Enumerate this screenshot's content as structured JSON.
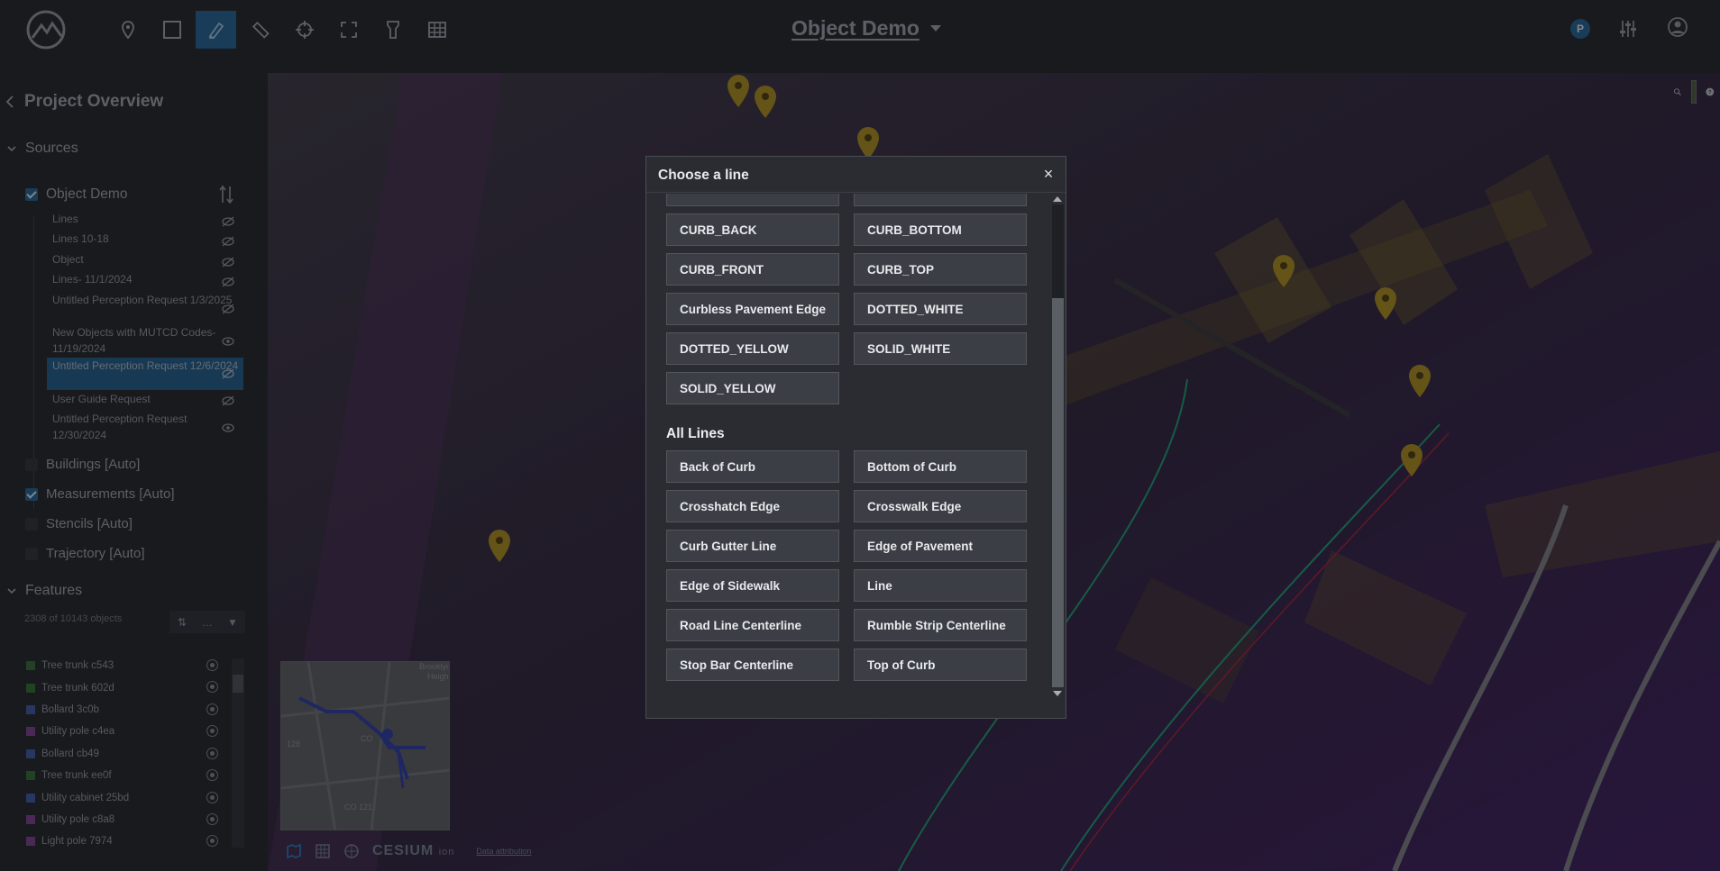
{
  "app": {
    "title": "Object Demo",
    "avatar_initial": "P",
    "toolbar_icons": [
      "pin-icon",
      "rectangle-icon",
      "pen-icon",
      "ruler-icon",
      "crosshair-icon",
      "fullscreen-icon",
      "flashlight-icon",
      "grid-icon"
    ],
    "active_tool": "pen-icon"
  },
  "sidebar": {
    "title": "Project Overview",
    "sources_header": "Sources",
    "source_name": "Object Demo",
    "layers": [
      {
        "label": "Lines",
        "visible": false
      },
      {
        "label": "Lines 10-18",
        "visible": false
      },
      {
        "label": "Object",
        "visible": false
      },
      {
        "label": "Lines- 11/1/2024",
        "visible": false
      },
      {
        "label": "Untitled Perception Request 1/3/2025",
        "visible": false
      },
      {
        "label": "New Objects with MUTCD Codes- 11/19/2024",
        "visible": true
      },
      {
        "label": "Untitled Perception Request 12/6/2024",
        "visible": false,
        "selected": true
      },
      {
        "label": "User Guide Request",
        "visible": false
      },
      {
        "label": "Untitled Perception Request 12/30/2024",
        "visible": true
      }
    ],
    "other_sources": [
      {
        "label": "Buildings [Auto]",
        "checked": false
      },
      {
        "label": "Measurements [Auto]",
        "checked": true
      },
      {
        "label": "Stencils [Auto]",
        "checked": false
      },
      {
        "label": "Trajectory [Auto]",
        "checked": false
      }
    ],
    "features_header": "Features",
    "features_count": "2308 of 10143 objects",
    "features": [
      {
        "label": "Tree trunk c543",
        "color": "#2f6b2f"
      },
      {
        "label": "Tree trunk 602d",
        "color": "#2f6b2f"
      },
      {
        "label": "Bollard 3c0b",
        "color": "#3b55a0"
      },
      {
        "label": "Utility pole c4ea",
        "color": "#7a3d8a"
      },
      {
        "label": "Bollard cb49",
        "color": "#3b55a0"
      },
      {
        "label": "Tree trunk ee0f",
        "color": "#2f6b2f"
      },
      {
        "label": "Utility cabinet 25bd",
        "color": "#3b55a0"
      },
      {
        "label": "Utility pole c8a8",
        "color": "#7a3d8a"
      },
      {
        "label": "Light pole 7974",
        "color": "#7a3d8a"
      }
    ]
  },
  "map": {
    "cesium_label": "CESIUM",
    "cesium_suffix": "ion",
    "attribution": "Data attribution",
    "minimap_labels": [
      "Brooklyn Height",
      "128",
      "CO",
      "CO 121"
    ]
  },
  "modal": {
    "title": "Choose a line",
    "close": "×",
    "recent_lines": [
      "CURB_BACK",
      "CURB_BOTTOM",
      "CURB_FRONT",
      "CURB_TOP",
      "Curbless Pavement Edge",
      "DOTTED_WHITE",
      "DOTTED_YELLOW",
      "SOLID_WHITE",
      "SOLID_YELLOW"
    ],
    "all_lines_header": "All Lines",
    "all_lines": [
      "Back of Curb",
      "Bottom of Curb",
      "Crosshatch Edge",
      "Crosswalk Edge",
      "Curb Gutter Line",
      "Edge of Pavement",
      "Edge of Sidewalk",
      "Line",
      "Road Line Centerline",
      "Rumble Strip Centerline",
      "Stop Bar Centerline",
      "Top of Curb"
    ]
  }
}
